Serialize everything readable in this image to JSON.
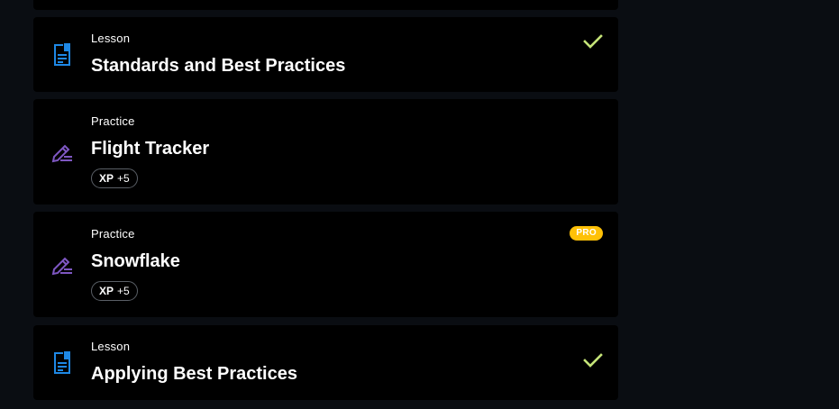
{
  "items": [
    {
      "kind": "Lesson",
      "title": "Standards and Best Practices",
      "icon": "lesson-doc-icon",
      "completed": true
    },
    {
      "kind": "Practice",
      "title": "Flight Tracker",
      "icon": "practice-pencil-icon",
      "xp_label": "XP",
      "xp_value": "+5"
    },
    {
      "kind": "Practice",
      "title": "Snowflake",
      "icon": "practice-pencil-icon",
      "xp_label": "XP",
      "xp_value": "+5",
      "pro_label": "PRO"
    },
    {
      "kind": "Lesson",
      "title": "Applying Best Practices",
      "icon": "lesson-doc-icon",
      "completed": true
    }
  ],
  "colors": {
    "page_bg": "#0a0d12",
    "card_bg": "#000000",
    "lesson_icon": "#1e88e5",
    "practice_icon": "#7e57c2",
    "check": "#c5e478",
    "pro_badge": "#ffc107"
  }
}
